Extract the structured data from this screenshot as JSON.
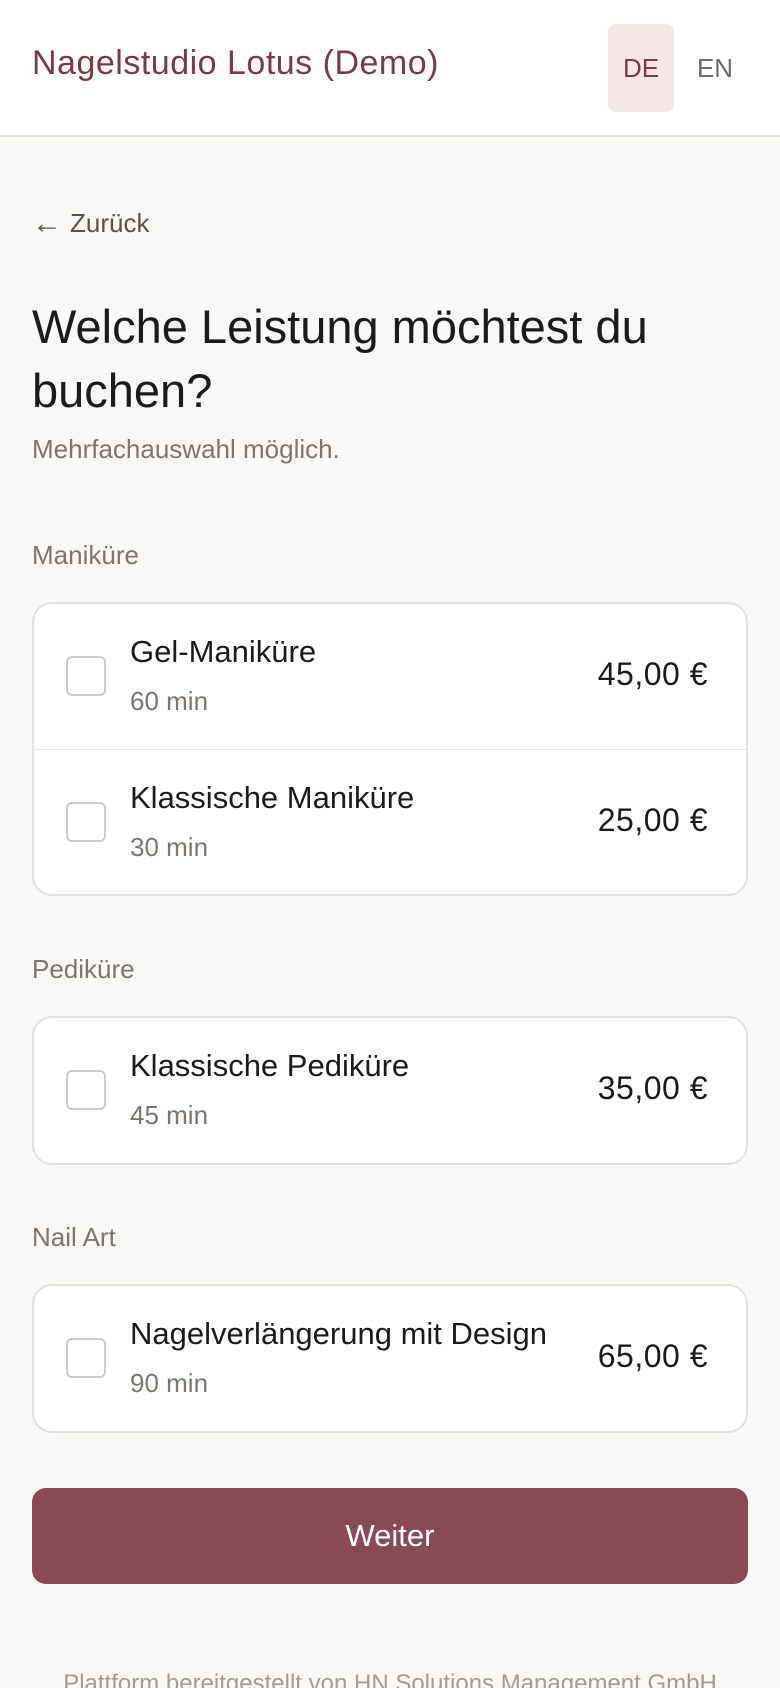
{
  "header": {
    "brand": "Nagelstudio Lotus (Demo)",
    "languages": [
      {
        "code": "DE",
        "active": true
      },
      {
        "code": "EN",
        "active": false
      }
    ]
  },
  "back": {
    "arrow": "←",
    "label": "Zurück"
  },
  "title": "Welche Leistung möchtest du buchen?",
  "subtitle": "Mehrfachauswahl möglich.",
  "categories": [
    {
      "label": "Maniküre",
      "services": [
        {
          "name": "Gel-Maniküre",
          "duration": "60 min",
          "price": "45,00 €",
          "checked": false
        },
        {
          "name": "Klassische Maniküre",
          "duration": "30 min",
          "price": "25,00 €",
          "checked": false
        }
      ]
    },
    {
      "label": "Pediküre",
      "services": [
        {
          "name": "Klassische Pediküre",
          "duration": "45 min",
          "price": "35,00 €",
          "checked": false
        }
      ]
    },
    {
      "label": "Nail Art",
      "services": [
        {
          "name": "Nagelverlängerung mit Design",
          "duration": "90 min",
          "price": "65,00 €",
          "checked": false
        }
      ]
    }
  ],
  "cta": {
    "label": "Weiter"
  },
  "footer": {
    "text": "Plattform bereitgestellt von HN Solutions Management GmbH"
  },
  "colors": {
    "brand": "#7a3a47",
    "cta_background": "#8a4a55",
    "active_language_bg": "#f5e6e7",
    "page_background": "#f9f8f6"
  }
}
